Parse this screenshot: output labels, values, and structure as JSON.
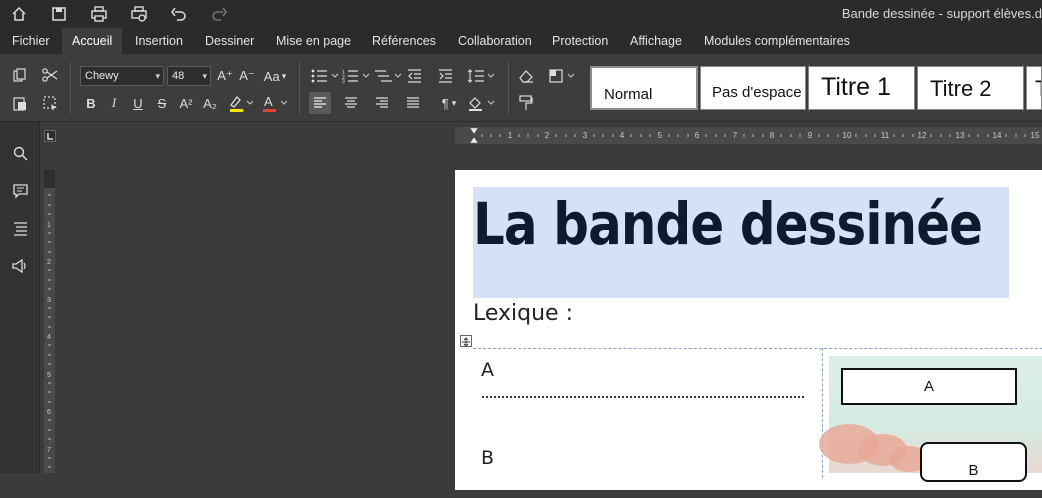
{
  "titlebar": {
    "document_title": "Bande dessinée - support élèves.d"
  },
  "quick_access": [
    "home-icon",
    "save-icon",
    "print-icon",
    "print-preview-icon",
    "undo-icon",
    "redo-icon"
  ],
  "menu": {
    "items": [
      {
        "label": "Fichier"
      },
      {
        "label": "Accueil",
        "active": true
      },
      {
        "label": "Insertion"
      },
      {
        "label": "Dessiner"
      },
      {
        "label": "Mise en page"
      },
      {
        "label": "Références"
      },
      {
        "label": "Collaboration"
      },
      {
        "label": "Protection"
      },
      {
        "label": "Affichage"
      },
      {
        "label": "Modules complémentaires"
      }
    ]
  },
  "ribbon": {
    "font_name": "Chewy",
    "font_size": "48",
    "superscript_symbol": "A²",
    "subscript_symbol": "A₂",
    "bold": "B",
    "italic": "I",
    "underline": "U",
    "strike": "S",
    "grow": "A⁺",
    "shrink": "A⁻",
    "case": "Aa",
    "highlight_color": "#f2e600",
    "font_color": "#e0443a",
    "styles": [
      {
        "label": "Normal"
      },
      {
        "label": "Pas d'espace"
      },
      {
        "label": "Titre 1"
      },
      {
        "label": "Titre 2"
      },
      {
        "label": "T"
      }
    ]
  },
  "document": {
    "title": "La bande dessinée",
    "lexique": "Lexique :",
    "letters": [
      "A",
      "B"
    ],
    "image_labels": [
      "A",
      "B"
    ]
  },
  "colors": {
    "title_band": "#d6e0f7",
    "title_text": "#0f1a2e"
  }
}
